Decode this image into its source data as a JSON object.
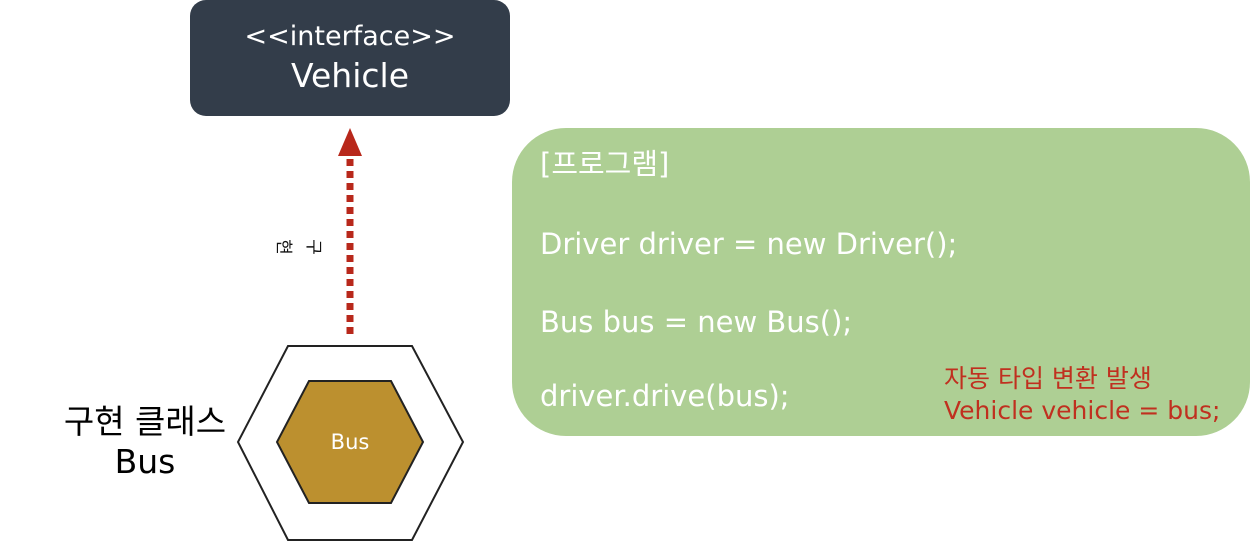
{
  "interface": {
    "stereotype": "<<interface>>",
    "name": "Vehicle"
  },
  "relation": {
    "label": "구현"
  },
  "implementation": {
    "title": "구현 클래스",
    "name": "Bus",
    "hexagon_label": "Bus"
  },
  "program": {
    "header": "[프로그램]",
    "lines": [
      "Driver driver = new Driver();",
      "Bus bus = new Bus();",
      "driver.drive(bus);"
    ],
    "note": {
      "line1": "자동 타입 변환 발생",
      "line2": "Vehicle vehicle = bus;"
    }
  },
  "colors": {
    "interface_box": "#333d4a",
    "arrow": "#b8281b",
    "hexagon_fill": "#bc902f",
    "program_box": "#aecf94",
    "note_text": "#c0301f"
  }
}
